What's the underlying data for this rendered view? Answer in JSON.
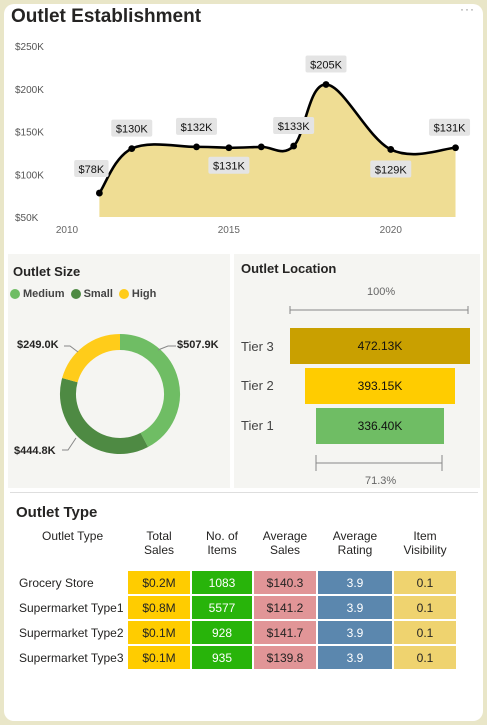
{
  "outlet_establishment": {
    "title": "Outlet Establishment"
  },
  "chart_data": [
    {
      "type": "area",
      "title": "Outlet Establishment",
      "x": [
        2011,
        2012,
        2014,
        2015,
        2016,
        2017,
        2018,
        2020,
        2022
      ],
      "values": [
        78,
        130,
        132,
        131,
        132,
        133,
        205,
        129,
        131
      ],
      "data_labels": [
        "$78K",
        "$130K",
        "$132K",
        "$131K",
        "",
        "$133K",
        "$205K",
        "$129K",
        "$131K"
      ],
      "y_ticks": [
        "$250K",
        "$200K",
        "$150K",
        "$100K",
        "$50K"
      ],
      "x_ticks": [
        "2010",
        "2015",
        "2020"
      ],
      "ylim": [
        50,
        250
      ],
      "xlim": [
        2010,
        2022.2
      ],
      "grid": false,
      "fill_color": "#efdd94",
      "line_color": "#000000"
    },
    {
      "type": "pie",
      "title": "Outlet Size",
      "categories": [
        "Medium",
        "Small",
        "High"
      ],
      "values": [
        507.9,
        444.8,
        249.0
      ],
      "labels": [
        "$507.9K",
        "$444.8K",
        "$249.0K"
      ],
      "colors": [
        "#6fbd64",
        "#4e8a43",
        "#ffcc1a"
      ],
      "legend": "top-left",
      "donut": true
    },
    {
      "type": "bar",
      "title": "Outlet Location",
      "categories": [
        "Tier 3",
        "Tier 2",
        "Tier 1"
      ],
      "values": [
        472.13,
        393.15,
        336.4
      ],
      "labels": [
        "472.13K",
        "393.15K",
        "336.40K"
      ],
      "colors": [
        "#c9a000",
        "#ffcc00",
        "#6fbd64"
      ],
      "top_pct": "100%",
      "bottom_pct": "71.3%"
    }
  ],
  "outlet_type": {
    "title": "Outlet Type",
    "headers": [
      "Outlet Type",
      "Total Sales",
      "No. of Items",
      "Average Sales",
      "Average Rating",
      "Item Visibility"
    ],
    "rows": [
      [
        "Grocery Store",
        "$0.2M",
        "1083",
        "$140.3",
        "3.9",
        "0.1"
      ],
      [
        "Supermarket Type1",
        "$0.8M",
        "5577",
        "$141.2",
        "3.9",
        "0.1"
      ],
      [
        "Supermarket Type2",
        "$0.1M",
        "928",
        "$141.7",
        "3.9",
        "0.1"
      ],
      [
        "Supermarket Type3",
        "$0.1M",
        "935",
        "$139.8",
        "3.9",
        "0.1"
      ]
    ]
  },
  "more_options": "···"
}
